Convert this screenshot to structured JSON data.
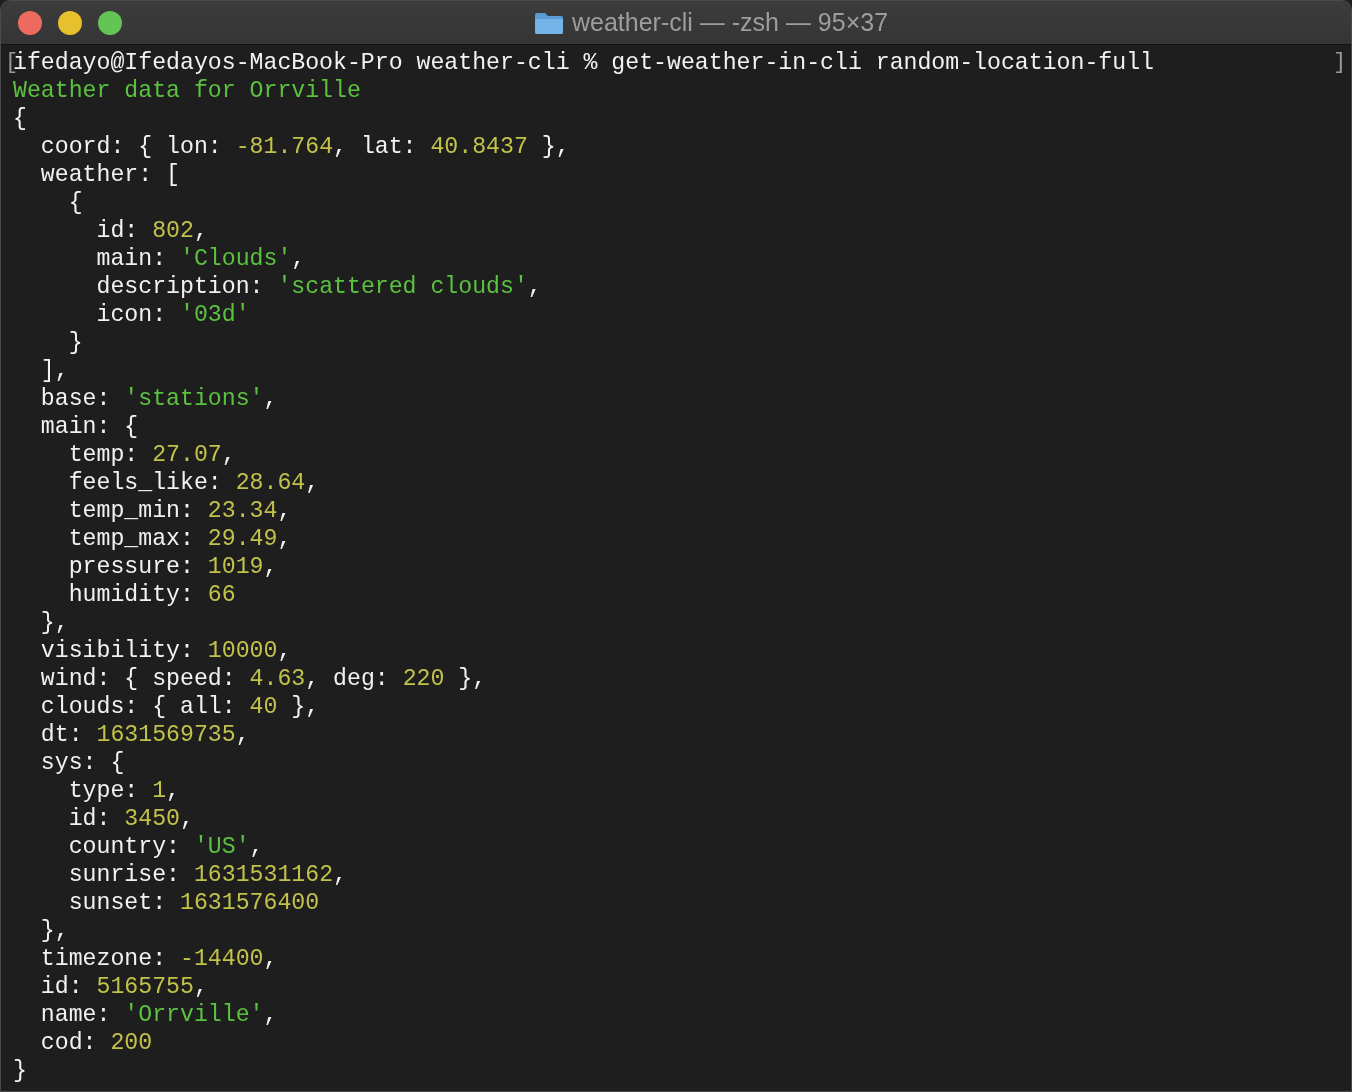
{
  "window": {
    "title": "weather-cli — -zsh — 95×37",
    "buttons": [
      {
        "kind": "close"
      },
      {
        "kind": "minimize"
      },
      {
        "kind": "zoom"
      }
    ]
  },
  "prompt": {
    "open_mark": "[",
    "command": "ifedayo@Ifedayos-MacBook-Pro weather-cli % get-weather-in-cli random-location-full",
    "close_mark": "]"
  },
  "output": [
    [
      {
        "kind": "heading",
        "text": "Weather data for Orrville"
      }
    ],
    [
      {
        "kind": "plain",
        "text": "{"
      }
    ],
    [
      {
        "kind": "plain",
        "text": "  coord: { lon: "
      },
      {
        "kind": "number",
        "text": "-81.764"
      },
      {
        "kind": "plain",
        "text": ", lat: "
      },
      {
        "kind": "number",
        "text": "40.8437"
      },
      {
        "kind": "plain",
        "text": " },"
      }
    ],
    [
      {
        "kind": "plain",
        "text": "  weather: ["
      }
    ],
    [
      {
        "kind": "plain",
        "text": "    {"
      }
    ],
    [
      {
        "kind": "plain",
        "text": "      id: "
      },
      {
        "kind": "number",
        "text": "802"
      },
      {
        "kind": "plain",
        "text": ","
      }
    ],
    [
      {
        "kind": "plain",
        "text": "      main: "
      },
      {
        "kind": "string",
        "text": "'Clouds'"
      },
      {
        "kind": "plain",
        "text": ","
      }
    ],
    [
      {
        "kind": "plain",
        "text": "      description: "
      },
      {
        "kind": "string",
        "text": "'scattered clouds'"
      },
      {
        "kind": "plain",
        "text": ","
      }
    ],
    [
      {
        "kind": "plain",
        "text": "      icon: "
      },
      {
        "kind": "string",
        "text": "'03d'"
      }
    ],
    [
      {
        "kind": "plain",
        "text": "    }"
      }
    ],
    [
      {
        "kind": "plain",
        "text": "  ],"
      }
    ],
    [
      {
        "kind": "plain",
        "text": "  base: "
      },
      {
        "kind": "string",
        "text": "'stations'"
      },
      {
        "kind": "plain",
        "text": ","
      }
    ],
    [
      {
        "kind": "plain",
        "text": "  main: {"
      }
    ],
    [
      {
        "kind": "plain",
        "text": "    temp: "
      },
      {
        "kind": "number",
        "text": "27.07"
      },
      {
        "kind": "plain",
        "text": ","
      }
    ],
    [
      {
        "kind": "plain",
        "text": "    feels_like: "
      },
      {
        "kind": "number",
        "text": "28.64"
      },
      {
        "kind": "plain",
        "text": ","
      }
    ],
    [
      {
        "kind": "plain",
        "text": "    temp_min: "
      },
      {
        "kind": "number",
        "text": "23.34"
      },
      {
        "kind": "plain",
        "text": ","
      }
    ],
    [
      {
        "kind": "plain",
        "text": "    temp_max: "
      },
      {
        "kind": "number",
        "text": "29.49"
      },
      {
        "kind": "plain",
        "text": ","
      }
    ],
    [
      {
        "kind": "plain",
        "text": "    pressure: "
      },
      {
        "kind": "number",
        "text": "1019"
      },
      {
        "kind": "plain",
        "text": ","
      }
    ],
    [
      {
        "kind": "plain",
        "text": "    humidity: "
      },
      {
        "kind": "number",
        "text": "66"
      }
    ],
    [
      {
        "kind": "plain",
        "text": "  },"
      }
    ],
    [
      {
        "kind": "plain",
        "text": "  visibility: "
      },
      {
        "kind": "number",
        "text": "10000"
      },
      {
        "kind": "plain",
        "text": ","
      }
    ],
    [
      {
        "kind": "plain",
        "text": "  wind: { speed: "
      },
      {
        "kind": "number",
        "text": "4.63"
      },
      {
        "kind": "plain",
        "text": ", deg: "
      },
      {
        "kind": "number",
        "text": "220"
      },
      {
        "kind": "plain",
        "text": " },"
      }
    ],
    [
      {
        "kind": "plain",
        "text": "  clouds: { all: "
      },
      {
        "kind": "number",
        "text": "40"
      },
      {
        "kind": "plain",
        "text": " },"
      }
    ],
    [
      {
        "kind": "plain",
        "text": "  dt: "
      },
      {
        "kind": "number",
        "text": "1631569735"
      },
      {
        "kind": "plain",
        "text": ","
      }
    ],
    [
      {
        "kind": "plain",
        "text": "  sys: {"
      }
    ],
    [
      {
        "kind": "plain",
        "text": "    type: "
      },
      {
        "kind": "number",
        "text": "1"
      },
      {
        "kind": "plain",
        "text": ","
      }
    ],
    [
      {
        "kind": "plain",
        "text": "    id: "
      },
      {
        "kind": "number",
        "text": "3450"
      },
      {
        "kind": "plain",
        "text": ","
      }
    ],
    [
      {
        "kind": "plain",
        "text": "    country: "
      },
      {
        "kind": "string",
        "text": "'US'"
      },
      {
        "kind": "plain",
        "text": ","
      }
    ],
    [
      {
        "kind": "plain",
        "text": "    sunrise: "
      },
      {
        "kind": "number",
        "text": "1631531162"
      },
      {
        "kind": "plain",
        "text": ","
      }
    ],
    [
      {
        "kind": "plain",
        "text": "    sunset: "
      },
      {
        "kind": "number",
        "text": "1631576400"
      }
    ],
    [
      {
        "kind": "plain",
        "text": "  },"
      }
    ],
    [
      {
        "kind": "plain",
        "text": "  timezone: "
      },
      {
        "kind": "number",
        "text": "-14400"
      },
      {
        "kind": "plain",
        "text": ","
      }
    ],
    [
      {
        "kind": "plain",
        "text": "  id: "
      },
      {
        "kind": "number",
        "text": "5165755"
      },
      {
        "kind": "plain",
        "text": ","
      }
    ],
    [
      {
        "kind": "plain",
        "text": "  name: "
      },
      {
        "kind": "string",
        "text": "'Orrville'"
      },
      {
        "kind": "plain",
        "text": ","
      }
    ],
    [
      {
        "kind": "plain",
        "text": "  cod: "
      },
      {
        "kind": "number",
        "text": "200"
      }
    ],
    [
      {
        "kind": "plain",
        "text": "}"
      }
    ]
  ]
}
